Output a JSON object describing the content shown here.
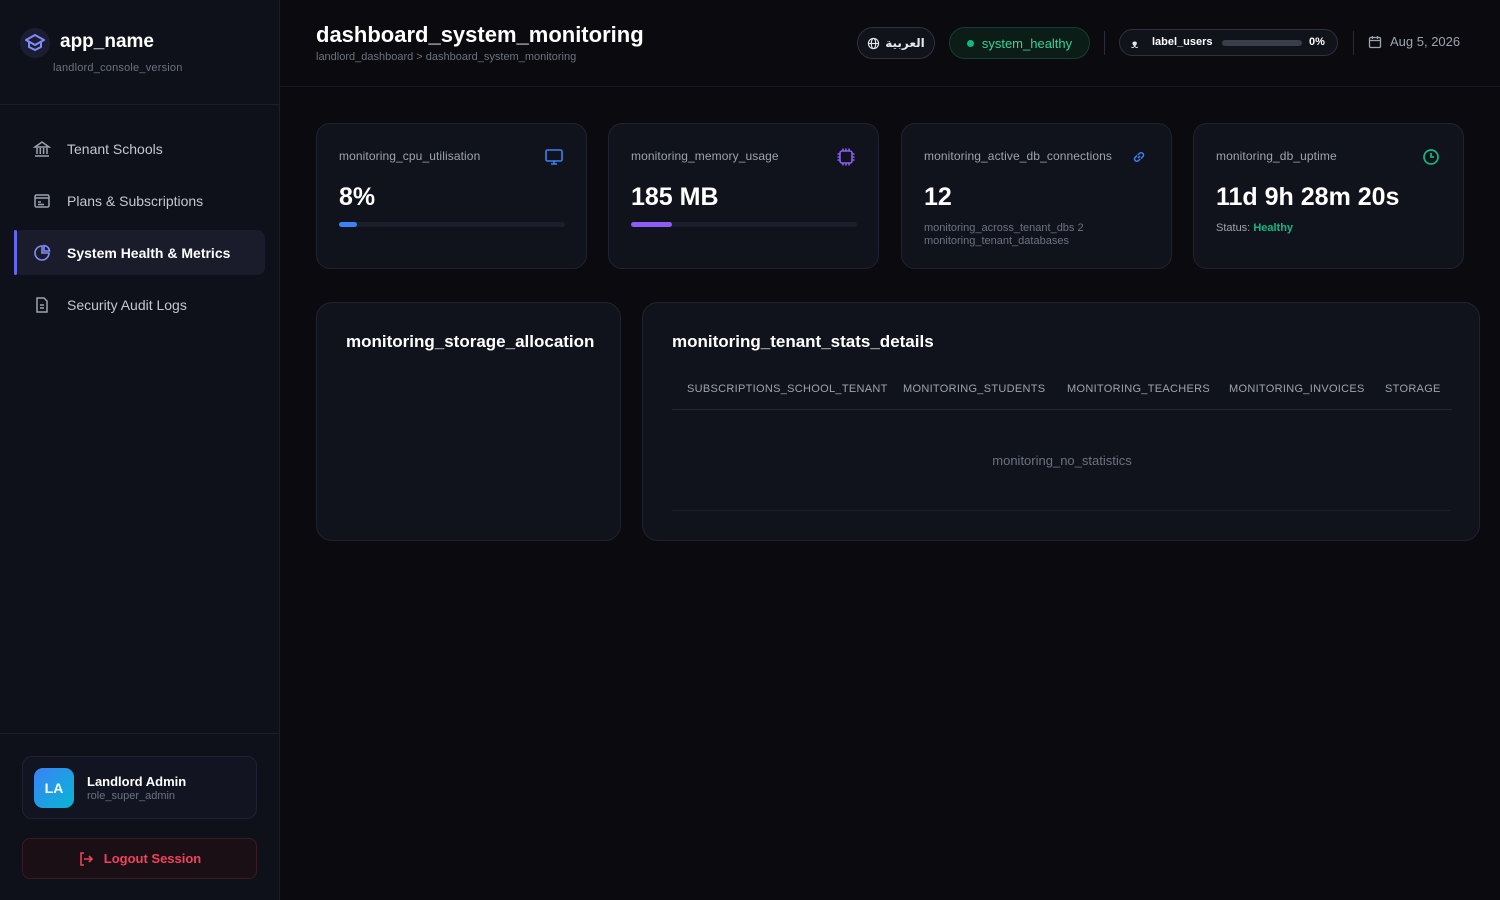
{
  "app": {
    "name": "app_name",
    "version": "landlord_console_version"
  },
  "sidebar": {
    "items": [
      {
        "label": "Tenant Schools",
        "icon": "bank-icon",
        "active": false
      },
      {
        "label": "Plans & Subscriptions",
        "icon": "card-icon",
        "active": false
      },
      {
        "label": "System Health & Metrics",
        "icon": "pie-chart-icon",
        "active": true
      },
      {
        "label": "Security Audit Logs",
        "icon": "document-icon",
        "active": false
      }
    ],
    "user": {
      "initials": "LA",
      "name": "Landlord Admin",
      "role": "role_super_admin"
    },
    "logout_label": "Logout Session"
  },
  "header": {
    "title": "dashboard_system_monitoring",
    "breadcrumb": "landlord_dashboard > dashboard_system_monitoring",
    "language_label": "العربية",
    "health_label": "system_healthy",
    "users": {
      "icon": "users-icon",
      "label": "label_users",
      "percent_text": "0%",
      "percent": 0
    },
    "date": "Aug 5, 2026"
  },
  "stats": {
    "cpu": {
      "label": "monitoring_cpu_utilisation",
      "value": "8%",
      "percent": 8,
      "color": "#3b82f6",
      "icon": "monitor-icon"
    },
    "memory": {
      "label": "monitoring_memory_usage",
      "value": "185 MB",
      "percent": 18,
      "color": "#8b5cf6",
      "icon": "chip-icon"
    },
    "connections": {
      "label": "monitoring_active_db_connections",
      "value": "12",
      "sub1": "monitoring_across_tenant_dbs 2",
      "sub2": "monitoring_tenant_databases",
      "icon": "link-icon",
      "color": "#3b82f6"
    },
    "uptime": {
      "label": "monitoring_db_uptime",
      "value": "11d 9h 28m 20s",
      "status_prefix": "Status:",
      "status": "Healthy",
      "icon": "clock-icon",
      "color": "#10b981"
    }
  },
  "storage_panel": {
    "title": "monitoring_storage_allocation"
  },
  "tenant_panel": {
    "title": "monitoring_tenant_stats_details",
    "columns": [
      "SUBSCRIPTIONS_SCHOOL_TENANT",
      "MONITORING_STUDENTS",
      "MONITORING_TEACHERS",
      "MONITORING_INVOICES",
      "STORAGE"
    ],
    "empty_text": "monitoring_no_statistics"
  }
}
